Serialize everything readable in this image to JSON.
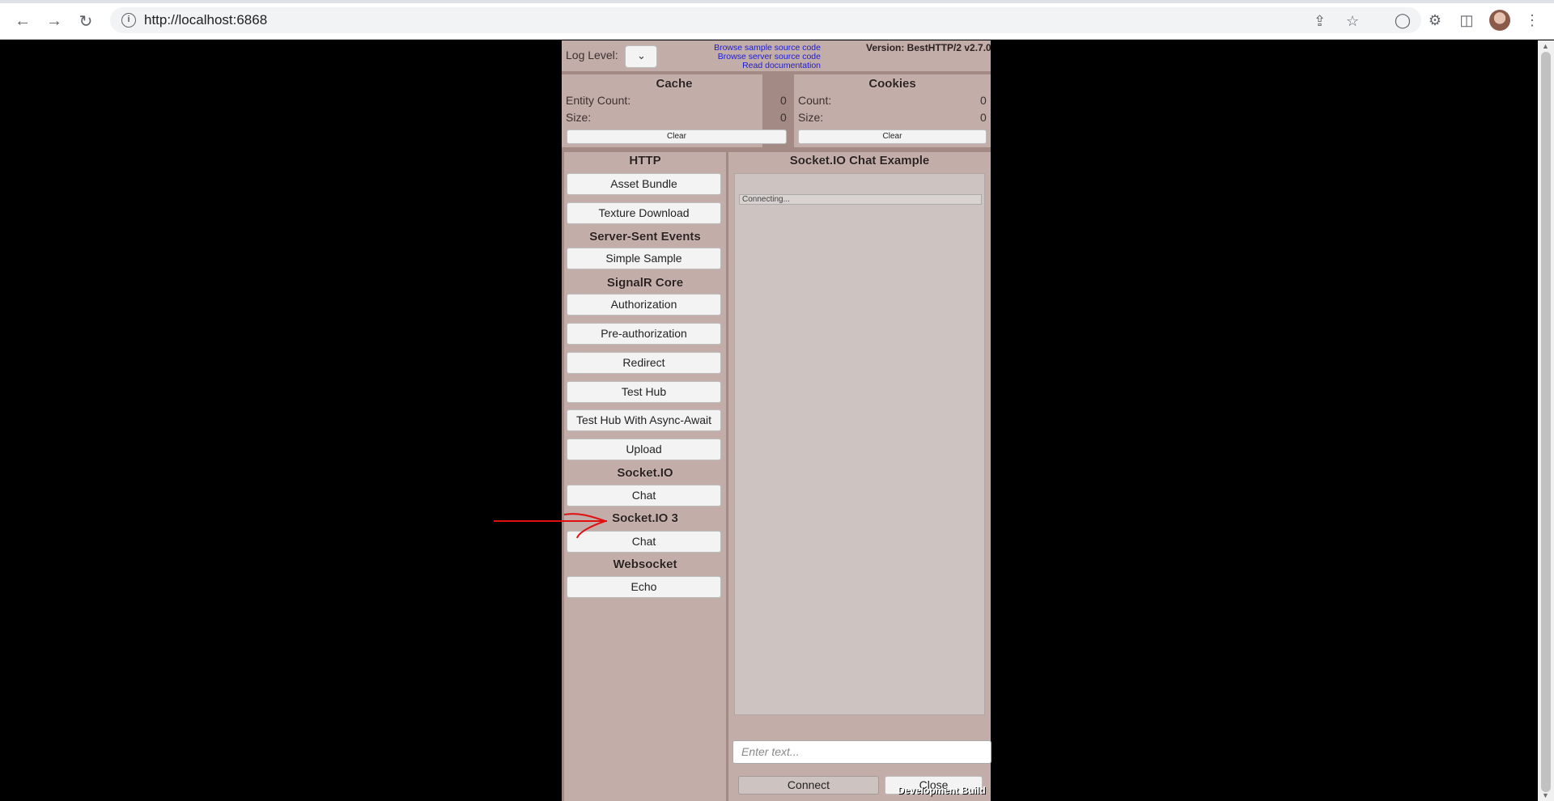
{
  "browser": {
    "url": "http://localhost:6868",
    "back_icon": "arrow-left-icon",
    "forward_icon": "arrow-right-icon",
    "reload_icon": "reload-icon",
    "info_icon": "info-icon"
  },
  "header": {
    "log_level_label": "Log Level:",
    "links": [
      "Browse sample source code",
      "Browse server source code",
      "Read documentation"
    ],
    "version": "Version: BestHTTP/2 v2.7.0"
  },
  "cache": {
    "title": "Cache",
    "entity_count_label": "Entity Count:",
    "entity_count_value": "0",
    "size_label": "Size:",
    "size_value": "0",
    "clear_label": "Clear"
  },
  "cookies": {
    "title": "Cookies",
    "count_label": "Count:",
    "count_value": "0",
    "size_label": "Size:",
    "size_value": "0",
    "clear_label": "Clear"
  },
  "sidebar": {
    "sections": [
      {
        "title": "HTTP",
        "items": [
          "Asset Bundle",
          "Texture Download"
        ]
      },
      {
        "title": "Server-Sent Events",
        "items": [
          "Simple Sample"
        ]
      },
      {
        "title": "SignalR Core",
        "items": [
          "Authorization",
          "Pre-authorization",
          "Redirect",
          "Test Hub",
          "Test Hub With Async-Await",
          "Upload"
        ]
      },
      {
        "title": "Socket.IO",
        "items": [
          "Chat"
        ]
      },
      {
        "title": "Socket.IO 3",
        "items": [
          "Chat"
        ]
      },
      {
        "title": "Websocket",
        "items": [
          "Echo"
        ]
      }
    ]
  },
  "main": {
    "title": "Socket.IO Chat Example",
    "status": "Connecting...",
    "input_placeholder": "Enter text...",
    "connect_label": "Connect",
    "close_label": "Close",
    "dev_build": "Development Build"
  },
  "colors": {
    "panel_bg": "#c2ada9",
    "frame_bg": "#a48a85",
    "link": "#1a1adc",
    "annotation_arrow": "#e01010"
  }
}
